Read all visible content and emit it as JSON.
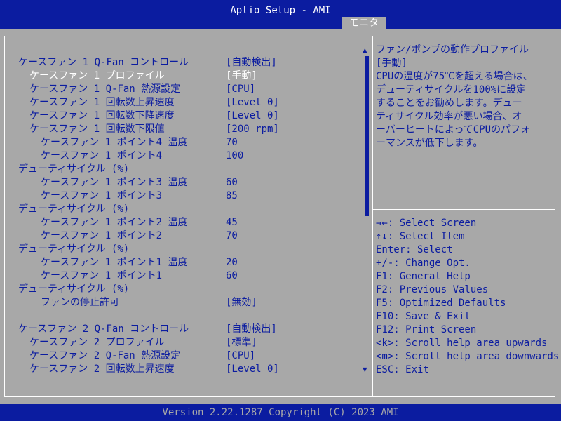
{
  "header": {
    "title": "Aptio Setup - AMI",
    "active_tab": "モニタ"
  },
  "settings": [
    {
      "label": "ケースファン 1 Q-Fan コントロール",
      "value": "[自動検出]",
      "indent": 0
    },
    {
      "label": "ケースファン 1 プロファイル",
      "value": "[手動]",
      "indent": 1,
      "selected": true
    },
    {
      "label": "ケースファン 1 Q-Fan 熱源設定",
      "value": "[CPU]",
      "indent": 1
    },
    {
      "label": "ケースファン 1 回転数上昇速度",
      "value": "[Level 0]",
      "indent": 1
    },
    {
      "label": "ケースファン 1 回転数下降速度",
      "value": "[Level 0]",
      "indent": 1
    },
    {
      "label": "ケースファン 1 回転数下限値",
      "value": "[200 rpm]",
      "indent": 1
    },
    {
      "label": "ケースファン 1 ポイント4 温度",
      "value": "70",
      "indent": 2
    },
    {
      "label": "ケースファン 1 ポイント4",
      "value": "100",
      "indent": 2
    },
    {
      "label": "デューティサイクル (%)",
      "value": "",
      "indent": 0
    },
    {
      "label": "ケースファン 1 ポイント3 温度",
      "value": "60",
      "indent": 2
    },
    {
      "label": "ケースファン 1 ポイント3",
      "value": "85",
      "indent": 2
    },
    {
      "label": "デューティサイクル (%)",
      "value": "",
      "indent": 0
    },
    {
      "label": "ケースファン 1 ポイント2 温度",
      "value": "45",
      "indent": 2
    },
    {
      "label": "ケースファン 1 ポイント2",
      "value": "70",
      "indent": 2
    },
    {
      "label": "デューティサイクル (%)",
      "value": "",
      "indent": 0
    },
    {
      "label": "ケースファン 1 ポイント1 温度",
      "value": "20",
      "indent": 2
    },
    {
      "label": "ケースファン 1 ポイント1",
      "value": "60",
      "indent": 2
    },
    {
      "label": "デューティサイクル (%)",
      "value": "",
      "indent": 0
    },
    {
      "label": "ファンの停止許可",
      "value": "[無効]",
      "indent": 2
    },
    {
      "label": "",
      "value": "",
      "indent": 0
    },
    {
      "label": "ケースファン 2 Q-Fan コントロール",
      "value": "[自動検出]",
      "indent": 0
    },
    {
      "label": "ケースファン 2 プロファイル",
      "value": "[標準]",
      "indent": 1
    },
    {
      "label": "ケースファン 2 Q-Fan 熱源設定",
      "value": "[CPU]",
      "indent": 1
    },
    {
      "label": "ケースファン 2 回転数上昇速度",
      "value": "[Level 0]",
      "indent": 1
    }
  ],
  "help": {
    "lines": [
      "ファン/ポンプの動作プロファイル",
      "[手動]",
      "CPUの温度が75℃を超える場合は、",
      "デューティサイクルを100%に設定",
      "することをお勧めします。デュー",
      "ティサイクル効率が悪い場合、オ",
      "ーバーヒートによってCPUのパフォ",
      "ーマンスが低下します。"
    ]
  },
  "keys": [
    "→←: Select Screen",
    "↑↓: Select Item",
    "Enter: Select",
    "+/-: Change Opt.",
    "F1: General Help",
    "F2: Previous Values",
    "F5: Optimized Defaults",
    "F10: Save & Exit",
    "F12: Print Screen",
    "<k>: Scroll help area upwards",
    "<m>: Scroll help area downwards",
    "ESC: Exit"
  ],
  "scroll": {
    "up_glyph": "▲",
    "down_glyph": "▼"
  },
  "footer": {
    "text": "Version 2.22.1287 Copyright (C) 2023 AMI"
  },
  "colors": {
    "bios_blue": "#0b1ca0",
    "bios_gray": "#a8a8a8",
    "highlight": "#ffffff"
  }
}
